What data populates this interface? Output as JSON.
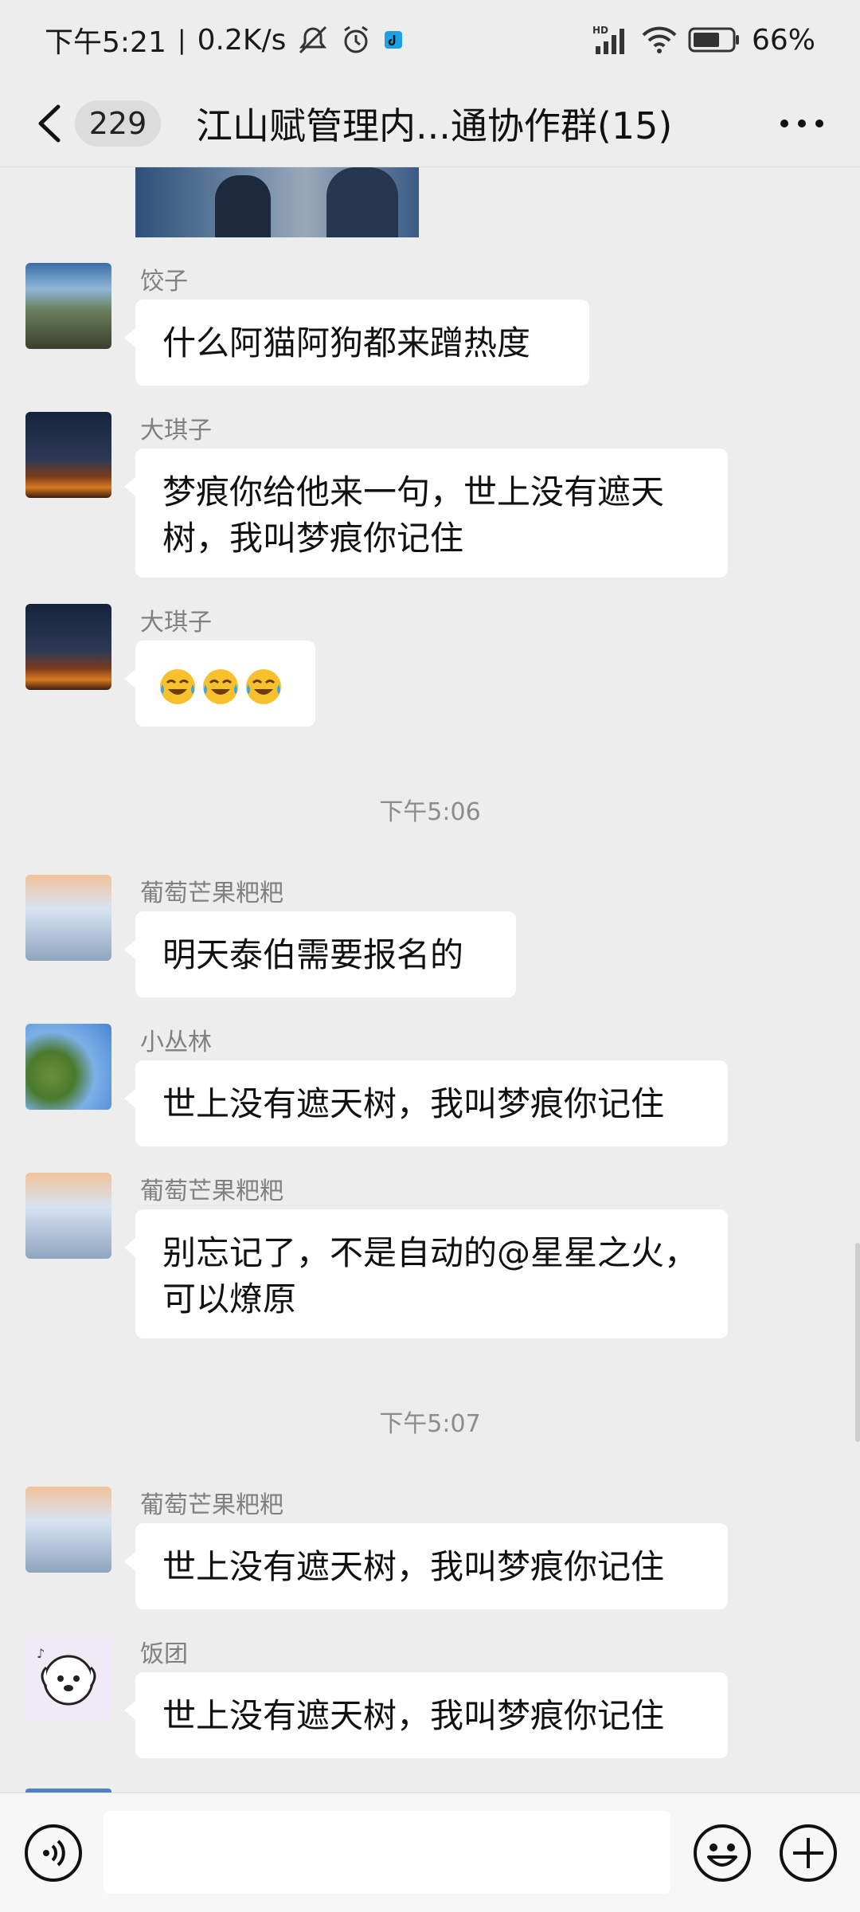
{
  "status_bar": {
    "time": "下午5:21",
    "speed": "0.2K/s",
    "network": "HD",
    "battery": "66%"
  },
  "nav": {
    "unread_count": "229",
    "title": "江山赋管理内...通协作群(15)"
  },
  "messages": [
    {
      "sender": "饺子",
      "text": "什么阿猫阿狗都来蹭热度",
      "avatar": "landscape-photo"
    },
    {
      "sender": "大琪子",
      "text_lines": [
        "梦痕你给他来一句，世上没有遮天",
        "树，我叫梦痕你记住"
      ],
      "avatar": "bonfire-photo"
    },
    {
      "sender": "大琪子",
      "emojis": [
        "laugh-cry-emoji",
        "laugh-cry-emoji",
        "laugh-cry-emoji"
      ],
      "avatar": "bonfire-photo"
    },
    {
      "sender": "葡萄芒果粑粑",
      "text": "明天泰伯需要报名的",
      "avatar": "person-photo"
    },
    {
      "sender": "小丛林",
      "text": "世上没有遮天树，我叫梦痕你记住",
      "avatar": "tree-photo"
    },
    {
      "sender": "葡萄芒果粑粑",
      "text_lines": [
        "别忘记了，不是自动的@星星之火，",
        "可以燎原"
      ],
      "avatar": "person-photo"
    },
    {
      "sender": "葡萄芒果粑粑",
      "text": "世上没有遮天树，我叫梦痕你记住",
      "avatar": "person-photo"
    },
    {
      "sender": "饭团",
      "text": "世上没有遮天树，我叫梦痕你记住",
      "avatar": "cartoon-dog"
    }
  ],
  "timestamps": [
    "下午5:06",
    "下午5:07"
  ],
  "input": {
    "value": "",
    "placeholder": ""
  }
}
